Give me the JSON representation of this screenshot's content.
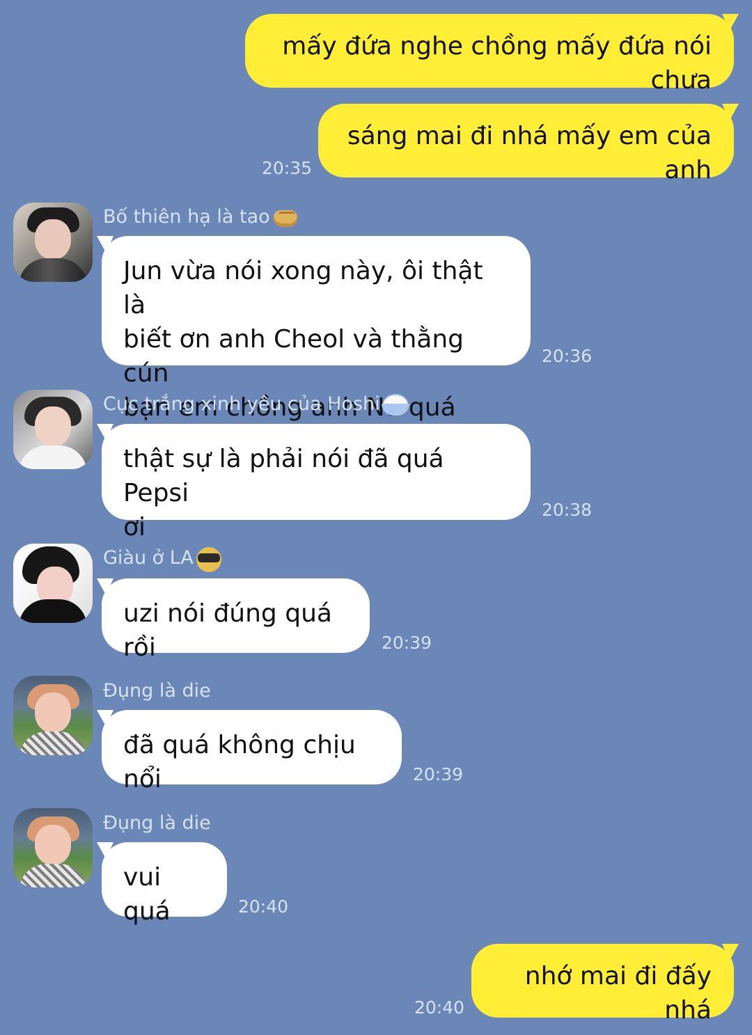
{
  "chat": {
    "messages": [
      {
        "direction": "outgoing",
        "text": "mấy đứa nghe chồng mấy đứa nói chưa",
        "time": ""
      },
      {
        "direction": "outgoing",
        "text": "sáng mai đi nhá mấy em của anh",
        "time": "20:35"
      },
      {
        "direction": "incoming",
        "sender": "Bố thiên hạ là tao",
        "sender_emoji": "fist-icon",
        "avatar": "avatar-person-1",
        "text": "Jun vừa nói xong này, ôi thật là\nbiết ơn anh Cheol và thằng cún\nbạn em chồng anh Nu quá",
        "time": "20:36"
      },
      {
        "direction": "incoming",
        "sender": "Cục trắng xinh yêu của Hoshi",
        "sender_emoji": "rice-bowl-icon",
        "avatar": "avatar-person-2",
        "text": "thật sự là phải nói đã quá Pepsi\nơi",
        "time": "20:38"
      },
      {
        "direction": "incoming",
        "sender": "Giàu ở LA",
        "sender_emoji": "sunglasses-icon",
        "avatar": "avatar-person-3",
        "text": "uzi nói đúng quá rồi",
        "time": "20:39"
      },
      {
        "direction": "incoming",
        "sender": "Đụng là die",
        "avatar": "avatar-person-4",
        "text": "đã quá không chịu nổi",
        "time": "20:39"
      },
      {
        "direction": "incoming",
        "sender": "Đụng là die",
        "avatar": "avatar-person-4",
        "text": "vui quá",
        "time": "20:40"
      },
      {
        "direction": "outgoing",
        "text": "nhớ mai đi đấy nhá",
        "time": "20:40"
      }
    ]
  },
  "colors": {
    "background": "#6a87b8",
    "outgoing_bubble": "#ffee35",
    "incoming_bubble": "#ffffff",
    "meta_text": "#d6e3f4"
  }
}
